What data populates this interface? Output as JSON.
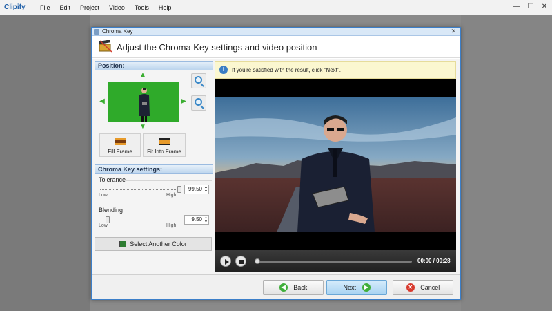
{
  "app": {
    "logo": "Clipify",
    "menu": [
      "File",
      "Edit",
      "Project",
      "Video",
      "Tools",
      "Help"
    ]
  },
  "dialog": {
    "title": "Chroma Key",
    "heading": "Adjust the Chroma Key settings and video position"
  },
  "position": {
    "section_title": "Position:",
    "fill_frame": "Fill Frame",
    "fit_into_frame": "Fit Into Frame"
  },
  "chroma": {
    "section_title": "Chroma Key settings:",
    "tolerance": {
      "label": "Tolerance",
      "value": "99.50",
      "low": "Low",
      "high": "High",
      "level": 0.995
    },
    "blending": {
      "label": "Blending",
      "value": "9.50",
      "low": "Low",
      "high": "High",
      "level": 0.095
    },
    "select_color_label": "Select Another Color",
    "key_color": "#2e7d32"
  },
  "preview": {
    "info_text": "If you're satisfied with the result, click \"Next\".",
    "time": "00:00 / 00:28",
    "progress": 0.0
  },
  "footer": {
    "back": "Back",
    "next": "Next",
    "cancel": "Cancel"
  }
}
